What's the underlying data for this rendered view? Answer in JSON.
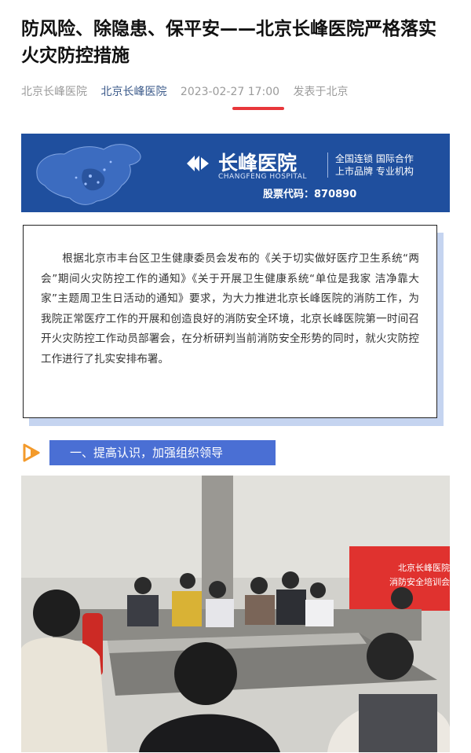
{
  "article": {
    "title": "防风险、除隐患、保平安——北京长峰医院严格落实火灾防控措施",
    "meta": {
      "source": "北京长峰医院",
      "account": "北京长峰医院",
      "datetime": "2023-02-27 17:00",
      "location": "发表于北京"
    },
    "underline_color": "#e8373b",
    "banner": {
      "brand_name": "长峰医院",
      "brand_en": "CHANGFENG HOSPITAL",
      "tagline_1": "全国连锁 国际合作",
      "tagline_2": "上市品牌 专业机构",
      "stock": "股票代码：870890",
      "background": "#1f4f9e",
      "icons": {
        "map": "china-map-graphic",
        "logo": "changfeng-logo-icon"
      }
    },
    "intro": "根据北京市丰台区卫生健康委员会发布的《关于切实做好医疗卫生系统“两会”期间火灾防控工作的通知》《关于开展卫生健康系统“单位是我家 洁净靠大家”主题周卫生日活动的通知》要求，为大力推进北京长峰医院的消防工作，为我院正常医疗工作的开展和创造良好的消防安全环境，北京长峰医院第一时间召开火灾防控工作动员部署会，在分析研判当前消防安全形势的同时，就火灾防控工作进行了扎实安排布署。",
    "section_1": {
      "label": "一、提高认识，加强组织领导",
      "bar_color": "#4a6fd4",
      "arrow_color": "#f39a2b"
    },
    "photo": {
      "screen_line_1": "北京长峰医院",
      "screen_line_2": "消防安全培训会议"
    }
  }
}
